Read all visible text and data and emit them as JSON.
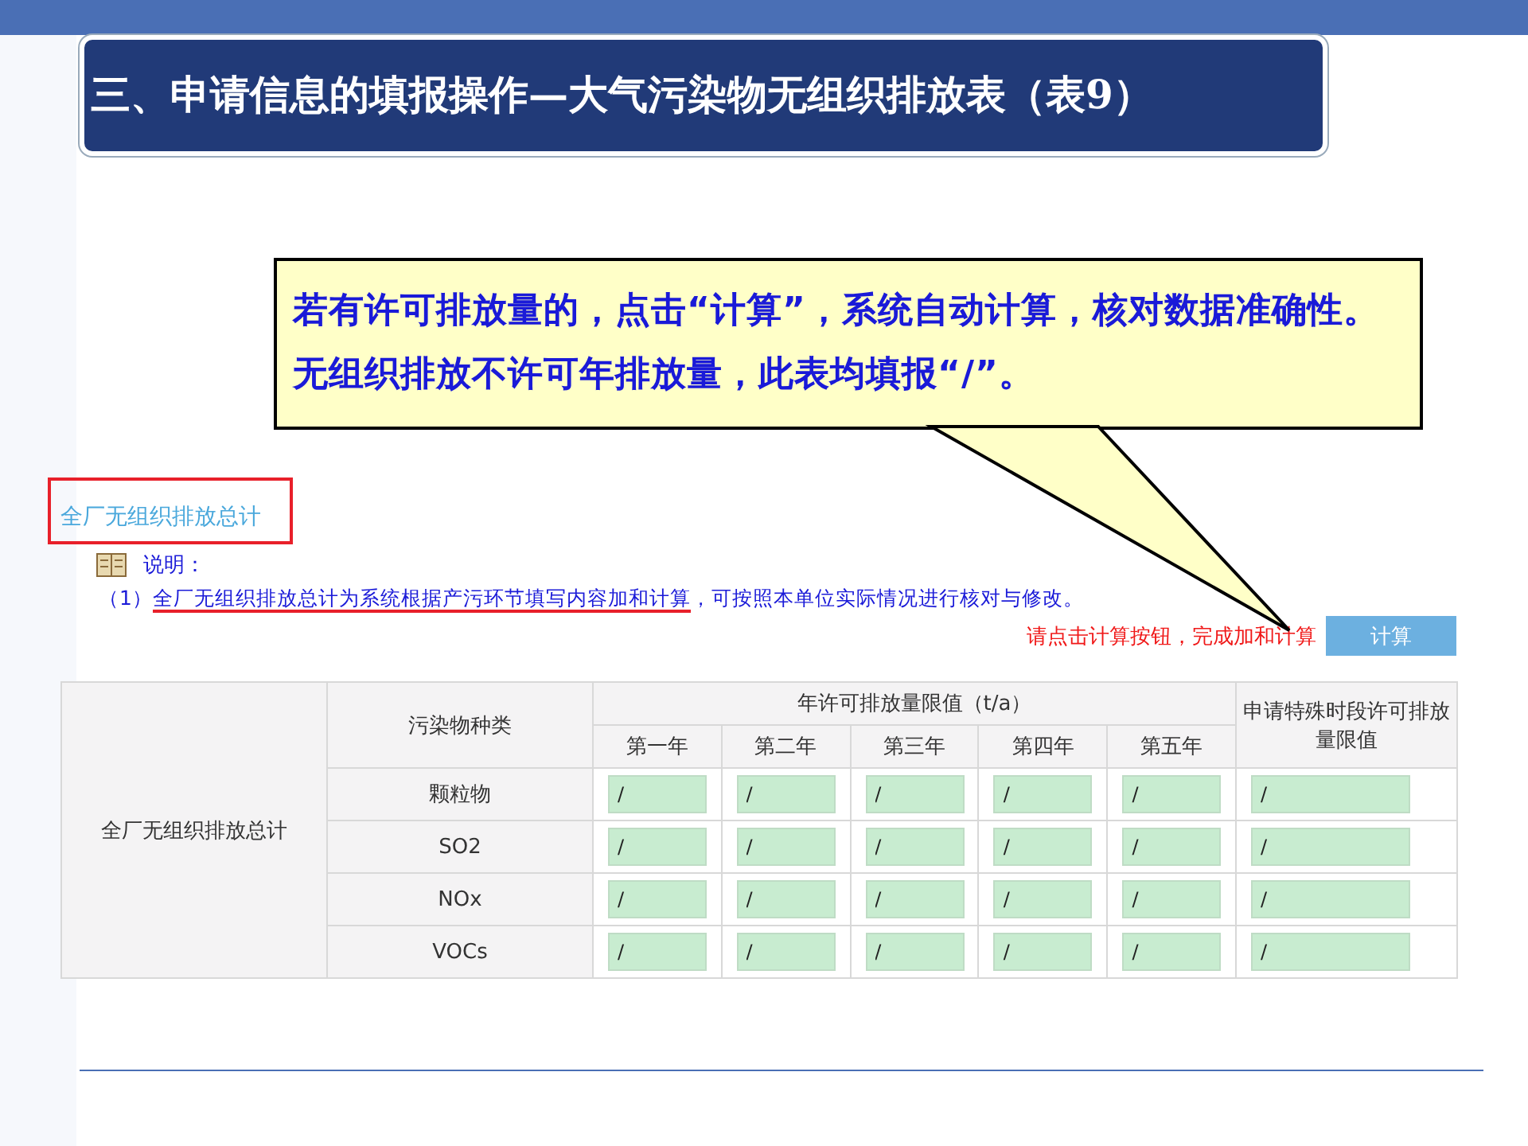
{
  "slide_title": "三、申请信息的填报操作—大气污染物无组织排放表（表9）",
  "callout": {
    "text": "若有许可排放量的，点击“计算”，系统自动计算，核对数据准确性。无组织排放不许可年排放量，此表均填报“/”。"
  },
  "section": {
    "title": "全厂无组织排放总计",
    "note_label": "说明：",
    "note_prefix": "（1）",
    "note_underlined": "全厂无组织排放总计为系统根据产污环节填写内容加和计算",
    "note_rest": "，可按照本单位实际情况进行核对与修改。",
    "hint": "请点击计算按钮，完成加和计算",
    "calc_button": "计算"
  },
  "table": {
    "row_label": "全厂无组织排放总计",
    "pollutant_header": "污染物种类",
    "annual_header": "年许可排放量限值（t/a）",
    "years": [
      "第一年",
      "第二年",
      "第三年",
      "第四年",
      "第五年"
    ],
    "special_header": "申请特殊时段许可排放量限值",
    "rows": [
      {
        "pollutant": "颗粒物",
        "values": [
          "/",
          "/",
          "/",
          "/",
          "/",
          "/"
        ]
      },
      {
        "pollutant": "SO2",
        "values": [
          "/",
          "/",
          "/",
          "/",
          "/",
          "/"
        ]
      },
      {
        "pollutant": "NOx",
        "values": [
          "/",
          "/",
          "/",
          "/",
          "/",
          "/"
        ]
      },
      {
        "pollutant": "VOCs",
        "values": [
          "/",
          "/",
          "/",
          "/",
          "/",
          "/"
        ]
      }
    ]
  }
}
